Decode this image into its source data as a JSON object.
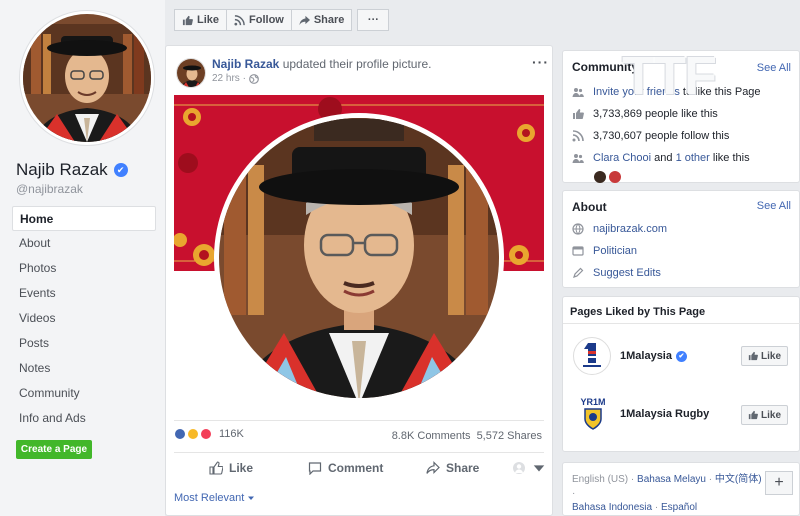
{
  "profile": {
    "name": "Najib Razak",
    "handle": "@najibrazak"
  },
  "nav": {
    "items": [
      "Home",
      "About",
      "Photos",
      "Events",
      "Videos",
      "Posts",
      "Notes",
      "Community",
      "Info and Ads"
    ],
    "create_page": "Create a Page"
  },
  "topbar": {
    "like": "Like",
    "follow": "Follow",
    "share": "Share",
    "more": "···"
  },
  "post": {
    "author": "Najib Razak",
    "action": "updated their profile picture.",
    "time": "22 hrs ·",
    "reactions_count": "116K",
    "comments": "8.8K Comments",
    "shares": "5,572 Shares",
    "like_label": "Like",
    "comment_label": "Comment",
    "share_label": "Share",
    "most_relevant": "Most Relevant"
  },
  "community": {
    "title": "Community",
    "see_all": "See All",
    "invite_link": "Invite your friends",
    "invite_rest": "to like this Page",
    "likes": "3,733,869 people like this",
    "follows": "3,730,607 people follow this",
    "friend_a": "Clara Chooi",
    "friend_and": "and",
    "friend_b": "1 other",
    "friend_rest": "like this"
  },
  "about": {
    "title": "About",
    "see_all": "See All",
    "website": "najibrazak.com",
    "category": "Politician",
    "suggest": "Suggest Edits"
  },
  "pages_liked": {
    "title": "Pages Liked by This Page",
    "items": [
      {
        "name": "1Malaysia",
        "like": "Like"
      },
      {
        "name": "1Malaysia Rugby",
        "like": "Like"
      }
    ]
  },
  "languages": {
    "line1": [
      "English (US)",
      "Bahasa Melayu",
      "中文(简体)"
    ],
    "line2": [
      "Bahasa Indonesia",
      "Español"
    ],
    "add": "+"
  },
  "watermark": "TTF",
  "colors": {
    "fb_blue": "#4267b2",
    "green": "#42b72a",
    "cover_red": "#c8102e",
    "gown_red": "#d9312b"
  }
}
